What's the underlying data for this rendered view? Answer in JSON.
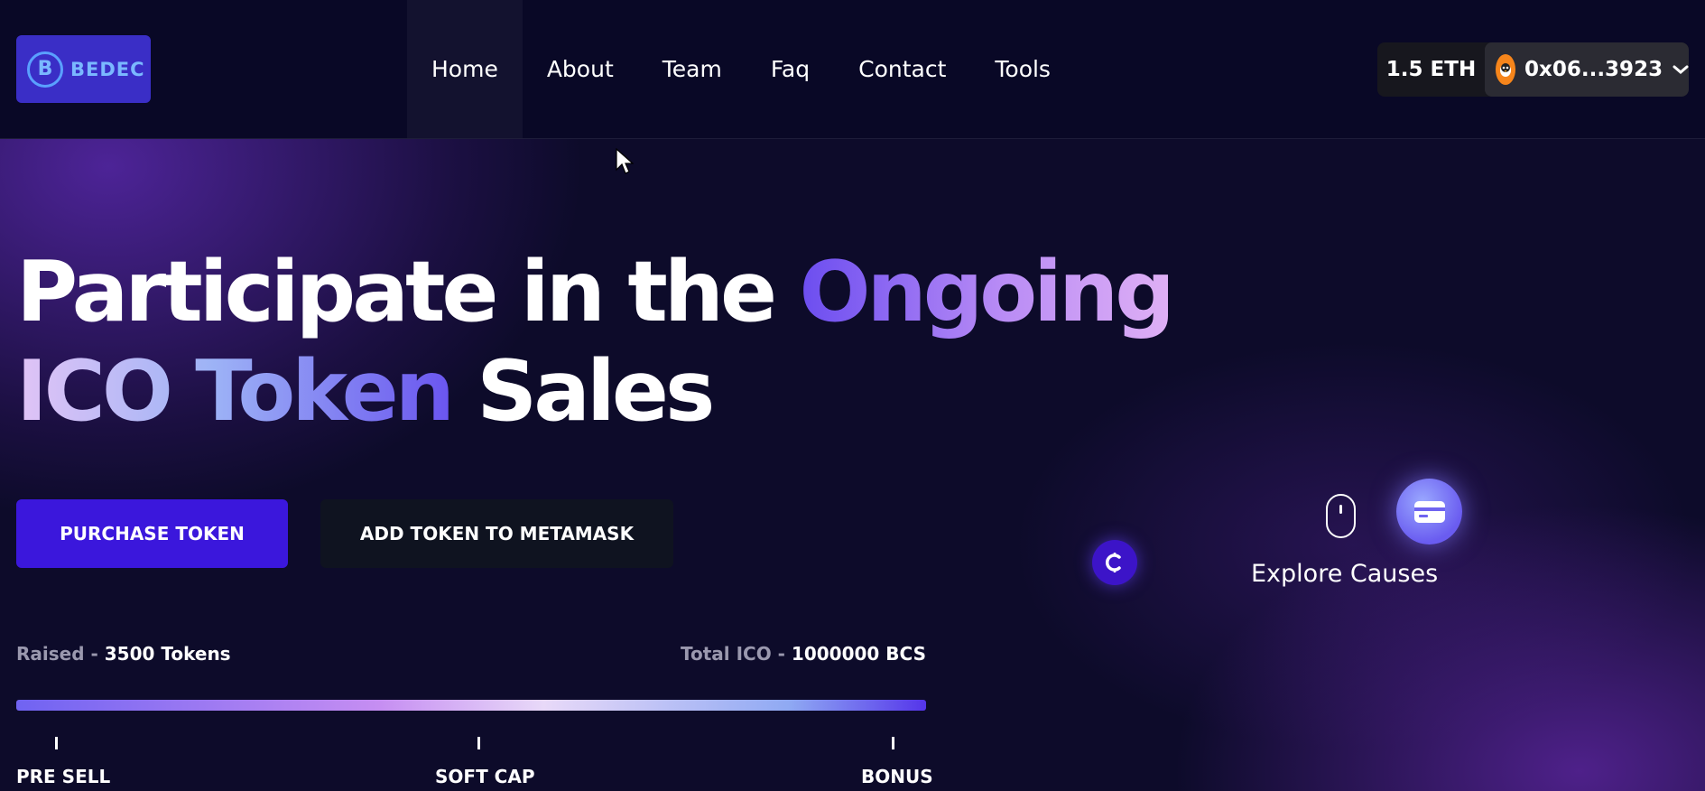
{
  "logo": {
    "badge": "B",
    "text": "BEDEC"
  },
  "nav": {
    "items": [
      {
        "label": "Home",
        "active": true
      },
      {
        "label": "About"
      },
      {
        "label": "Team"
      },
      {
        "label": "Faq"
      },
      {
        "label": "Contact"
      },
      {
        "label": "Tools"
      }
    ]
  },
  "wallet": {
    "balance": "1.5 ETH",
    "address": "0x06...3923",
    "avatar_icon": "metamask-fox-icon"
  },
  "hero": {
    "headline": {
      "part1": "Participate in the ",
      "part2": "Ongoing",
      "part3": "ICO Token",
      "part4": " Sales"
    },
    "buttons": {
      "purchase": "PURCHASE TOKEN",
      "metamask": "ADD TOKEN TO METAMASK"
    },
    "raised_label": "Raised - ",
    "raised_value": "3500 Tokens",
    "total_label": "Total ICO - ",
    "total_value": "1000000 BCS",
    "milestones": [
      "PRE SELL",
      "SOFT CAP",
      "BONUS"
    ],
    "explore": "Explore Causes"
  },
  "colors": {
    "accent": "#3b17dc",
    "navbar": "#090826",
    "logo_bg": "#3a2ec6"
  }
}
